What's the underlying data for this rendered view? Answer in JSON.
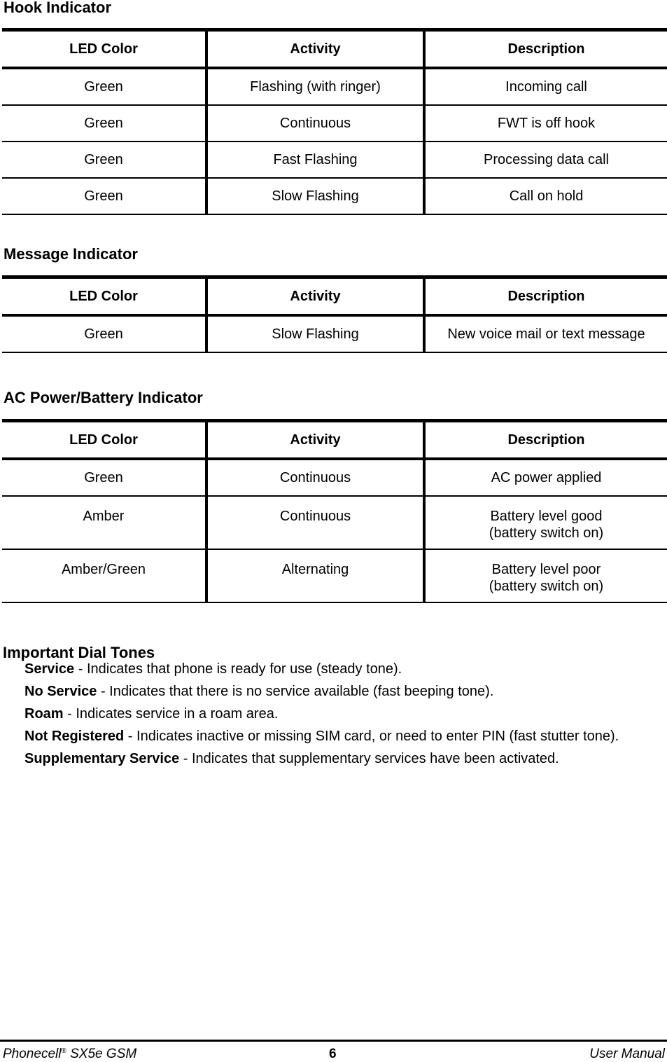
{
  "hook": {
    "title": "Hook Indicator",
    "headers": [
      "LED Color",
      "Activity",
      "Description"
    ],
    "rows": [
      [
        "Green",
        "Flashing (with ringer)",
        "Incoming call"
      ],
      [
        "Green",
        "Continuous",
        "FWT is off hook"
      ],
      [
        "Green",
        "Fast Flashing",
        "Processing data call"
      ],
      [
        "Green",
        "Slow Flashing",
        "Call on hold"
      ]
    ]
  },
  "message": {
    "title": "Message Indicator",
    "headers": [
      "LED Color",
      "Activity",
      "Description"
    ],
    "rows": [
      [
        "Green",
        "Slow Flashing",
        "New voice mail or text message"
      ]
    ]
  },
  "ac_power": {
    "title": "AC Power/Battery Indicator",
    "headers": [
      "LED Color",
      "Activity",
      "Description"
    ],
    "rows": [
      [
        "Green",
        "Continuous",
        "AC power applied"
      ],
      [
        "Amber",
        "Continuous",
        "Battery level good",
        "(battery switch on)"
      ],
      [
        "Amber/Green",
        "Alternating",
        "Battery level poor",
        "(battery switch on)"
      ]
    ]
  },
  "dial_tones": {
    "title": "Important Dial Tones",
    "items": [
      {
        "term": "Service",
        "text": " - Indicates that phone is ready for use (steady tone)."
      },
      {
        "term": "No Service",
        "text": " - Indicates that there is no service available (fast beeping tone)."
      },
      {
        "term": "Roam",
        "text": " - Indicates service in a roam area."
      },
      {
        "term": "Not Registered",
        "text": " - Indicates inactive or missing SIM card, or need to enter PIN (fast stutter tone)."
      },
      {
        "term": "Supplementary Service",
        "text": " - Indicates that supplementary services have been activated."
      }
    ]
  },
  "footer": {
    "product": "Phonecell",
    "registered": "®",
    "model": " SX5e GSM",
    "page_number": "6",
    "doc_type": "User Manual"
  }
}
